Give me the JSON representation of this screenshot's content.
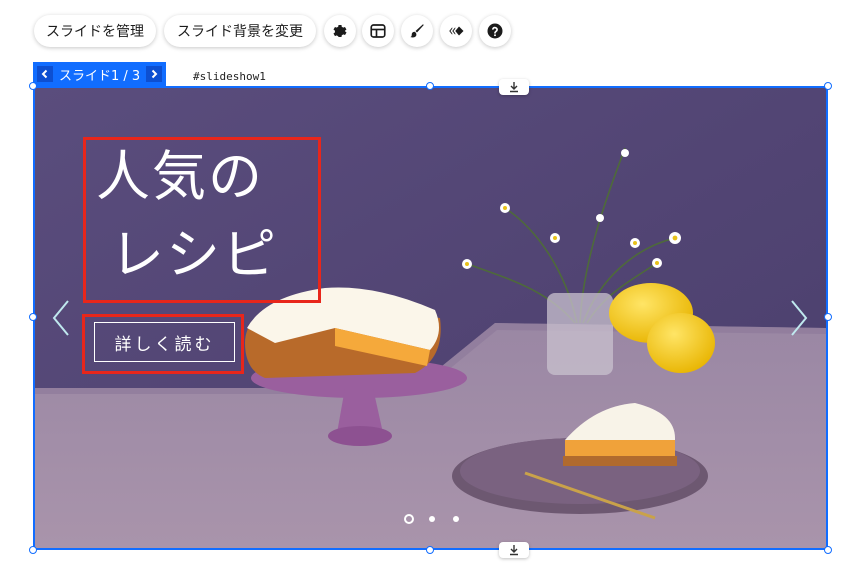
{
  "toolbar": {
    "manage_slides": "スライドを管理",
    "change_background": "スライド背景を変更",
    "icons": [
      "gear-icon",
      "layout-icon",
      "design-brush-icon",
      "animation-icon",
      "help-icon"
    ]
  },
  "slide_nav": {
    "label": "スライド1 / 3"
  },
  "element_id": "#slideshow1",
  "slide": {
    "title_line1": "人気の",
    "title_line2": "レシピ",
    "button_label": "詳しく読む",
    "total_slides": 3,
    "current_slide": 1
  },
  "colors": {
    "accent": "#116dff",
    "highlight_box": "#e8261b",
    "backdrop": "#574b7a",
    "table": "#a58ea8"
  }
}
